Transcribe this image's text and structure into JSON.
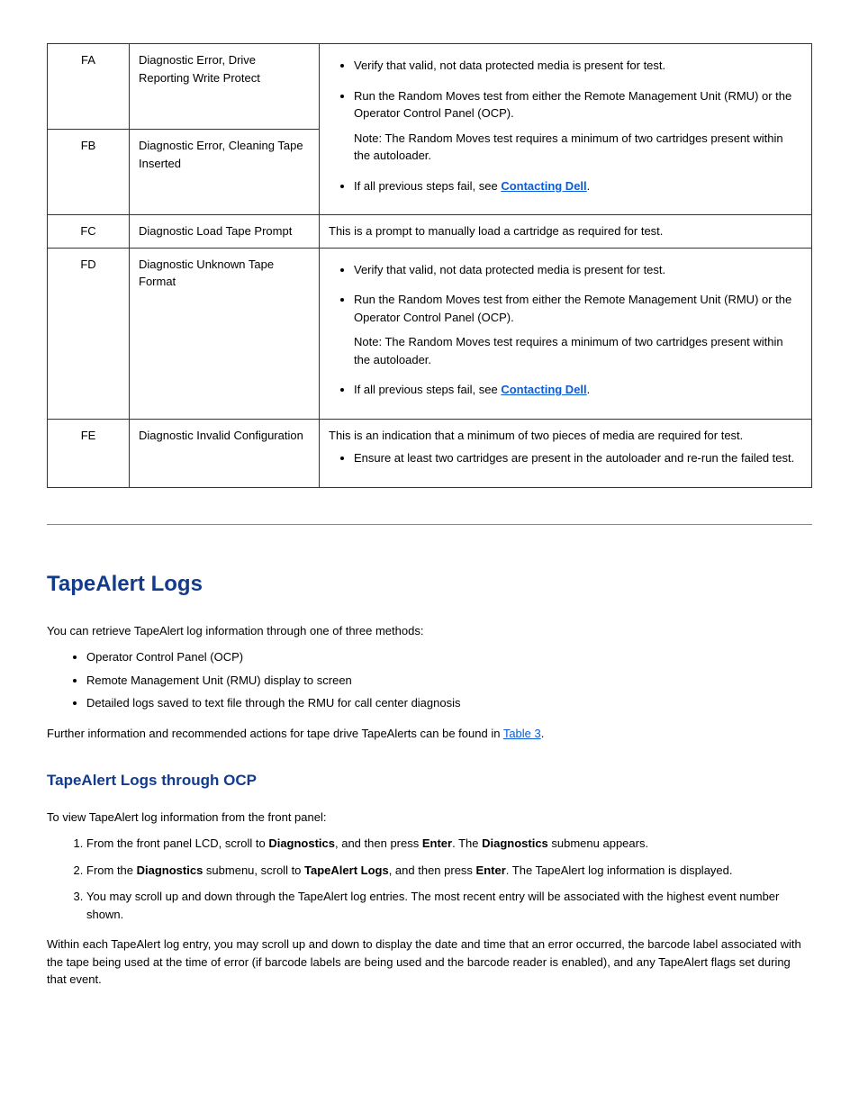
{
  "rows": {
    "fa": {
      "code": "FA",
      "desc": "Diagnostic Error, Drive Reporting Write Protect"
    },
    "fb": {
      "code": "FB",
      "desc": "Diagnostic Error, Cleaning Tape Inserted",
      "b1": "Verify that valid, not data protected media is present for test.",
      "b2": "Run the Random Moves test from either the Remote Management Unit (RMU) or the Operator Control Panel (OCP).",
      "note": "Note: The Random Moves test requires a minimum of two cartridges present within the autoloader.",
      "b3": "If all previous steps fail, see ",
      "link": "Contacting Dell"
    },
    "fc": {
      "code": "FC",
      "desc": "Diagnostic Load Tape Prompt",
      "text": "This is a prompt to manually load a cartridge as required for test."
    },
    "fd": {
      "code": "FD",
      "desc": "Diagnostic Unknown Tape Format",
      "b1": "Verify that valid, not data protected media is present for test.",
      "b2": "Run the Random Moves test from either the Remote Management Unit (RMU) or the Operator Control Panel (OCP).",
      "note": "Note: The Random Moves test requires a minimum of two cartridges present within the autoloader.",
      "b3": "If all previous steps fail, see ",
      "link": "Contacting Dell"
    },
    "fe": {
      "code": "FE",
      "desc": "Diagnostic Invalid Configuration",
      "text": "This is an indication that a minimum of two pieces of media are required for test.",
      "b1": "Ensure at least two cartridges are present in the autoloader and re-run the failed test."
    }
  },
  "section": {
    "title": "TapeAlert Logs",
    "intro": "You can retrieve TapeAlert log information through one of three methods:",
    "methods": {
      "m1": "Operator Control Panel (OCP)",
      "m2": "Remote Management Unit (RMU) display to screen",
      "m3": "Detailed logs saved to text file through the RMU for call center diagnosis"
    },
    "further_pre": "Further information and recommended actions for tape drive TapeAlerts can be found in ",
    "further_link": "Table 3",
    "further_post": "."
  },
  "sub": {
    "title": "TapeAlert Logs through OCP",
    "intro": "To view TapeAlert log information from the front panel:",
    "s1_a": "From the front panel LCD, scroll to ",
    "s1_b": "Diagnostics",
    "s1_c": ", and then press ",
    "s1_d": "Enter",
    "s1_e": ". The ",
    "s1_f": "Diagnostics",
    "s1_g": " submenu appears.",
    "s2_a": "From the ",
    "s2_b": "Diagnostics",
    "s2_c": " submenu, scroll to ",
    "s2_d": "TapeAlert Logs",
    "s2_e": ", and then press ",
    "s2_f": "Enter",
    "s2_g": ". The TapeAlert log information is displayed.",
    "s3": "You may scroll up and down through the TapeAlert log entries. The most recent entry will be associated with the highest event number shown.",
    "closing": "Within each TapeAlert log entry, you may scroll up and down to display the date and time that an error occurred, the barcode label associated with the tape being used at the time of error (if barcode labels are being used and the barcode reader is enabled), and any TapeAlert flags set during that event."
  }
}
